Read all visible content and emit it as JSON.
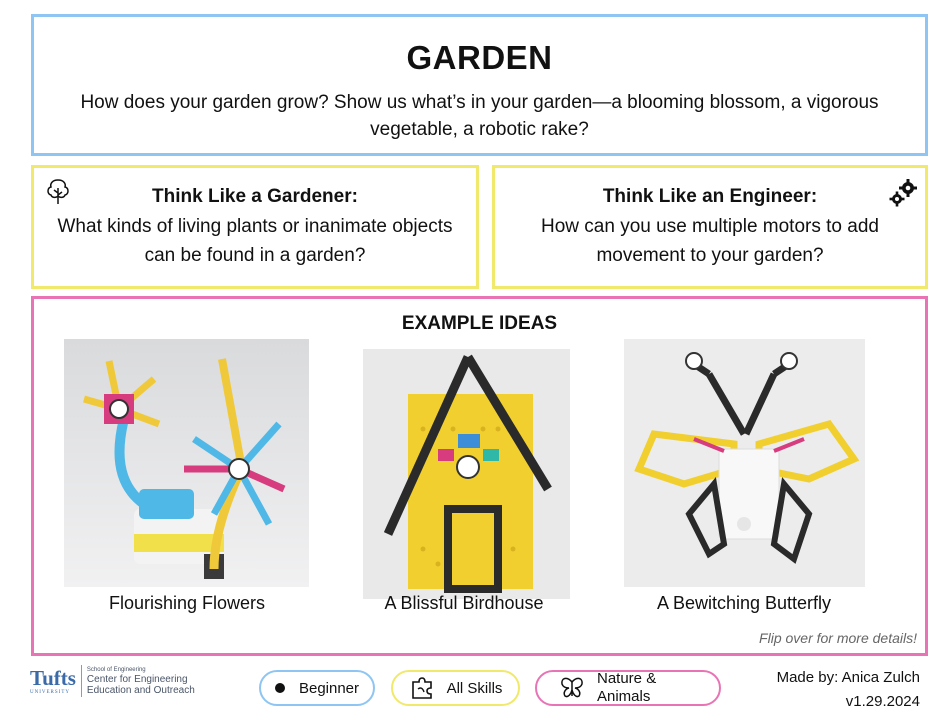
{
  "header": {
    "title": "GARDEN",
    "prompt": "How does your garden grow? Show us what’s in your garden—a blooming blossom, a vigorous vegetable, a robotic rake?"
  },
  "think_gardener": {
    "heading": "Think Like a Gardener:",
    "text": "What kinds of living plants or inanimate objects can be found in a garden?",
    "icon": "tree-icon"
  },
  "think_engineer": {
    "heading": "Think Like an Engineer:",
    "text": "How can you use multiple motors to add movement to your garden?",
    "icon": "gears-icon"
  },
  "examples": {
    "heading": "EXAMPLE IDEAS",
    "items": [
      {
        "caption": "Flourishing Flowers"
      },
      {
        "caption": "A Blissful Birdhouse"
      },
      {
        "caption": "A Bewitching Butterfly"
      }
    ],
    "note": "Flip over for more details!"
  },
  "footer": {
    "logo_word": "Tufts",
    "logo_sub": "UNIVERSITY",
    "logo_school": "School of Engineering",
    "logo_center": "Center for Engineering Education and Outreach",
    "badges": [
      {
        "label": "Beginner",
        "icon": "dot-icon"
      },
      {
        "label": "All Skills",
        "icon": "puzzle-icon"
      },
      {
        "label": "Nature & Animals",
        "icon": "butterfly-icon"
      }
    ],
    "made_by": "Made by: Anica Zulch",
    "version": "v1.29.2024"
  },
  "colors": {
    "blue_border": "#8ec5f2",
    "yellow_border": "#f0e96b",
    "pink_border": "#e974b5",
    "tufts_blue": "#3a6aa8"
  }
}
